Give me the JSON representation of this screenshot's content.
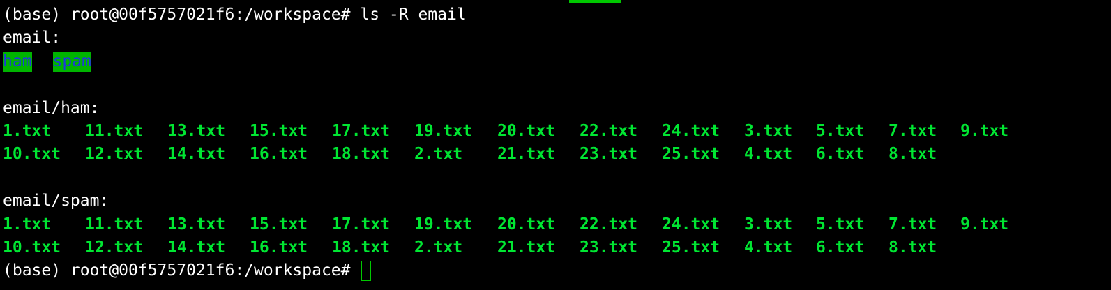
{
  "colors": {
    "background": "#000000",
    "text": "#ffffff",
    "file_green": "#00e632",
    "dir_highlight_bg": "#00b400",
    "dir_text_blue": "#1e3ad8",
    "cursor": "#00c800"
  },
  "command_line": {
    "prompt": "(base) root@00f5757021f6:/workspace#",
    "command": "ls -R email"
  },
  "sections": [
    {
      "header": "email:",
      "dirs": [
        "ham",
        "spam"
      ]
    },
    {
      "header": "email/ham:",
      "row1": [
        "1.txt",
        "11.txt",
        "13.txt",
        "15.txt",
        "17.txt",
        "19.txt",
        "20.txt",
        "22.txt",
        "24.txt",
        "3.txt",
        "5.txt",
        "7.txt",
        "9.txt"
      ],
      "row2": [
        "10.txt",
        "12.txt",
        "14.txt",
        "16.txt",
        "18.txt",
        "2.txt",
        "21.txt",
        "23.txt",
        "25.txt",
        "4.txt",
        "6.txt",
        "8.txt"
      ]
    },
    {
      "header": "email/spam:",
      "row1": [
        "1.txt",
        "11.txt",
        "13.txt",
        "15.txt",
        "17.txt",
        "19.txt",
        "20.txt",
        "22.txt",
        "24.txt",
        "3.txt",
        "5.txt",
        "7.txt",
        "9.txt"
      ],
      "row2": [
        "10.txt",
        "12.txt",
        "14.txt",
        "16.txt",
        "18.txt",
        "2.txt",
        "21.txt",
        "23.txt",
        "25.txt",
        "4.txt",
        "6.txt",
        "8.txt"
      ]
    }
  ],
  "final_prompt": "(base) root@00f5757021f6:/workspace#"
}
